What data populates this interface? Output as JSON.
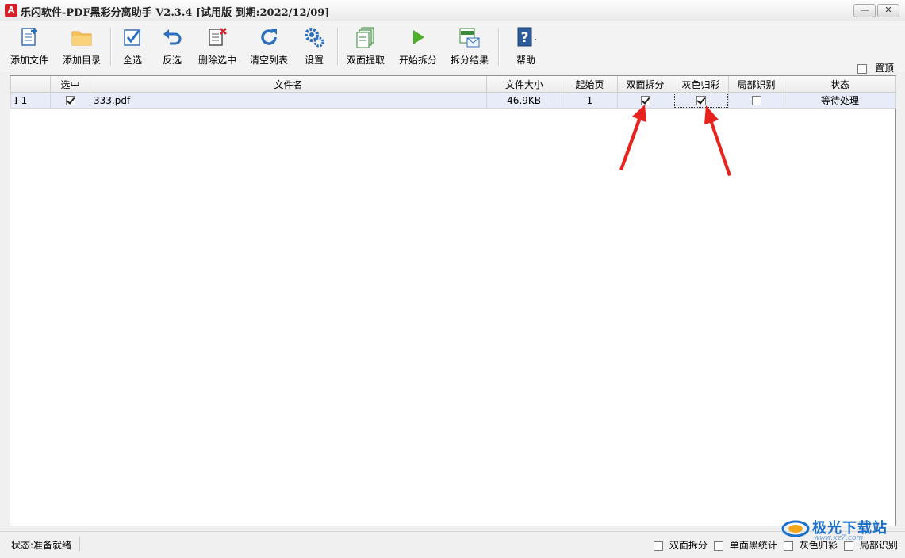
{
  "window": {
    "title": "乐闪软件-PDF黑彩分离助手 V2.3.4 [试用版 到期:2022/12/09]",
    "icon": "pdf-icon",
    "minimize": "—",
    "maximize": "□",
    "close": "✕"
  },
  "toolbar": {
    "add_file": "添加文件",
    "add_folder": "添加目录",
    "select_all": "全选",
    "invert": "反选",
    "delete_selected": "删除选中",
    "clear_list": "清空列表",
    "settings": "设置",
    "duplex_extract": "双面提取",
    "start_split": "开始拆分",
    "split_result": "拆分结果",
    "help": "帮助",
    "pin_top": "置顶"
  },
  "table": {
    "columns": [
      "",
      "选中",
      "文件名",
      "文件大小",
      "起始页",
      "双面拆分",
      "灰色归彩",
      "局部识别",
      "状态"
    ],
    "rows": [
      {
        "index": "1",
        "selected": true,
        "filename": "333.pdf",
        "size": "46.9KB",
        "start_page": "1",
        "duplex_split": true,
        "gray_to_color": true,
        "partial_recognize": false,
        "status": "等待处理"
      }
    ]
  },
  "statusbar": {
    "status": "状态:准备就绪",
    "opt_duplex": "双面拆分",
    "opt_single_black": "单面黑统计",
    "opt_gray_color": "灰色归彩",
    "opt_partial": "局部识别"
  },
  "watermark": {
    "text": "极光下载站",
    "url": "www.xz7.com"
  },
  "colors": {
    "accent_blue": "#2c6fbf",
    "arrow_red": "#e8231d",
    "row_highlight": "#e8ecf8"
  }
}
